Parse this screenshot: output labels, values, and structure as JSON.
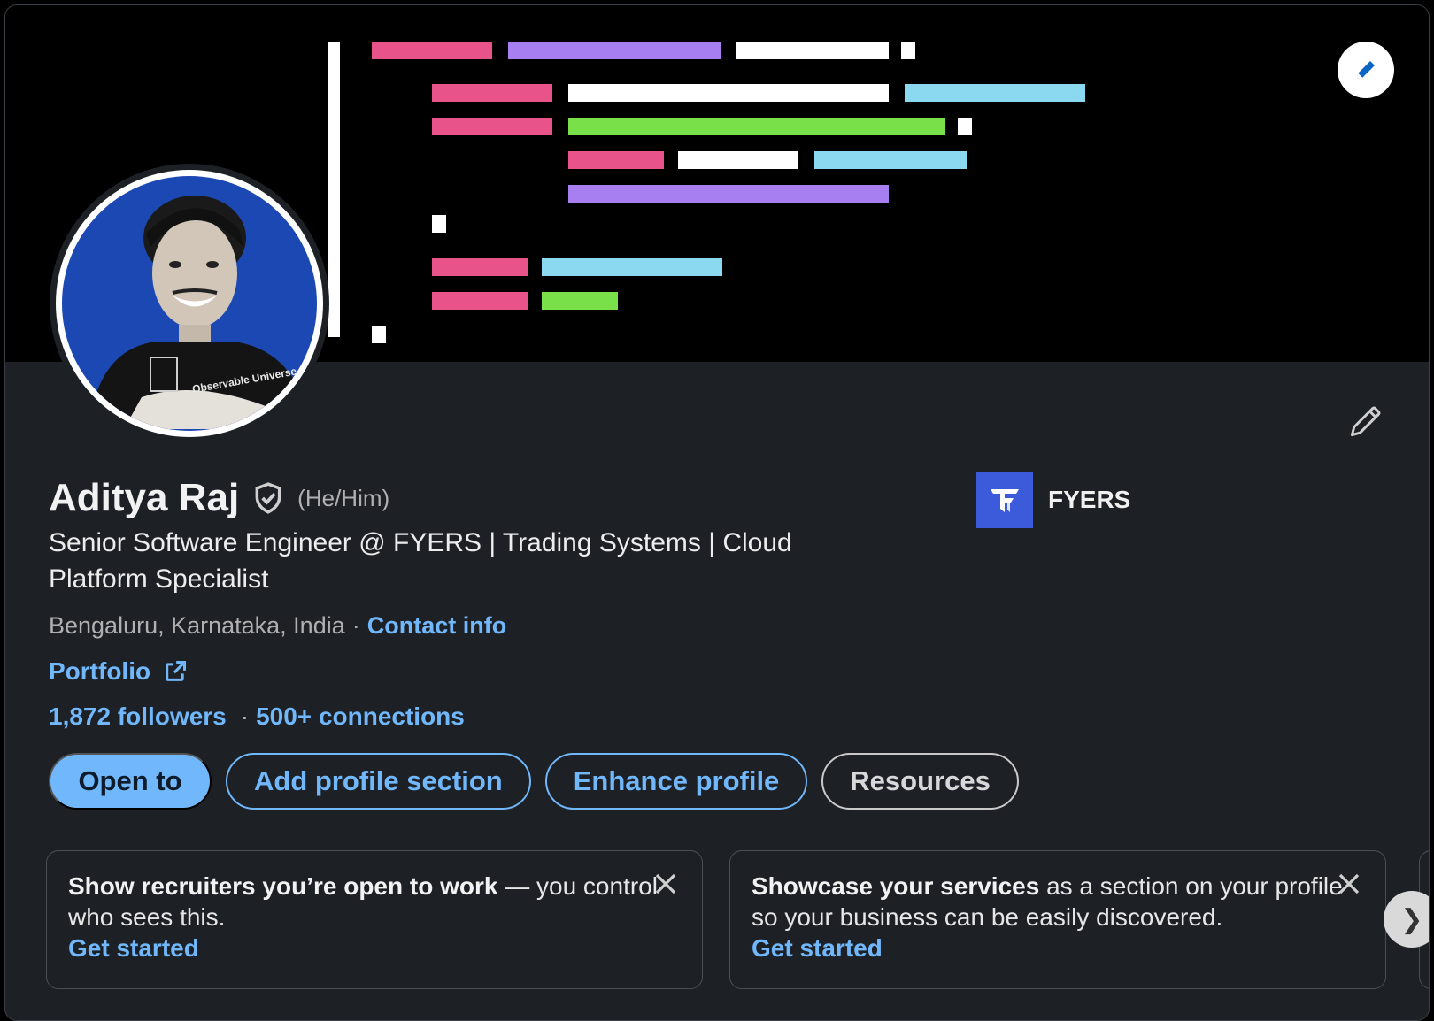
{
  "profile": {
    "name": "Aditya Raj",
    "pronouns": "(He/Him)",
    "headline": "Senior Software Engineer @ FYERS | Trading Systems | Cloud Platform Specialist",
    "location": "Bengaluru, Karnataka, India",
    "location_sep": "·",
    "contact_info": "Contact info",
    "portfolio": "Portfolio",
    "followers": "1,872 followers",
    "stats_sep": "·",
    "connections": "500+ connections",
    "avatar_shirt_text": "Observable Universe"
  },
  "company": {
    "name": "FYERS",
    "logo_color": "#3b5bdb"
  },
  "actions": {
    "open_to": "Open to",
    "add_section": "Add profile section",
    "enhance": "Enhance profile",
    "resources": "Resources"
  },
  "promos": [
    {
      "title": "Show recruiters you’re open to work",
      "body": " — you control who sees this.",
      "cta": "Get started"
    },
    {
      "title": "Showcase your services",
      "body": " as a section on your profile so your business can be easily discovered.",
      "cta": "Get started"
    }
  ],
  "carousel": {
    "next_glyph": "❯"
  },
  "colors": {
    "accent": "#71b7fb",
    "card_bg": "#1d2126",
    "banner_pink": "#e8538a",
    "banner_purple": "#a87ff0",
    "banner_cyan": "#8ad9f0",
    "banner_green": "#7ae04a",
    "avatar_bg": "#1c48b3"
  }
}
